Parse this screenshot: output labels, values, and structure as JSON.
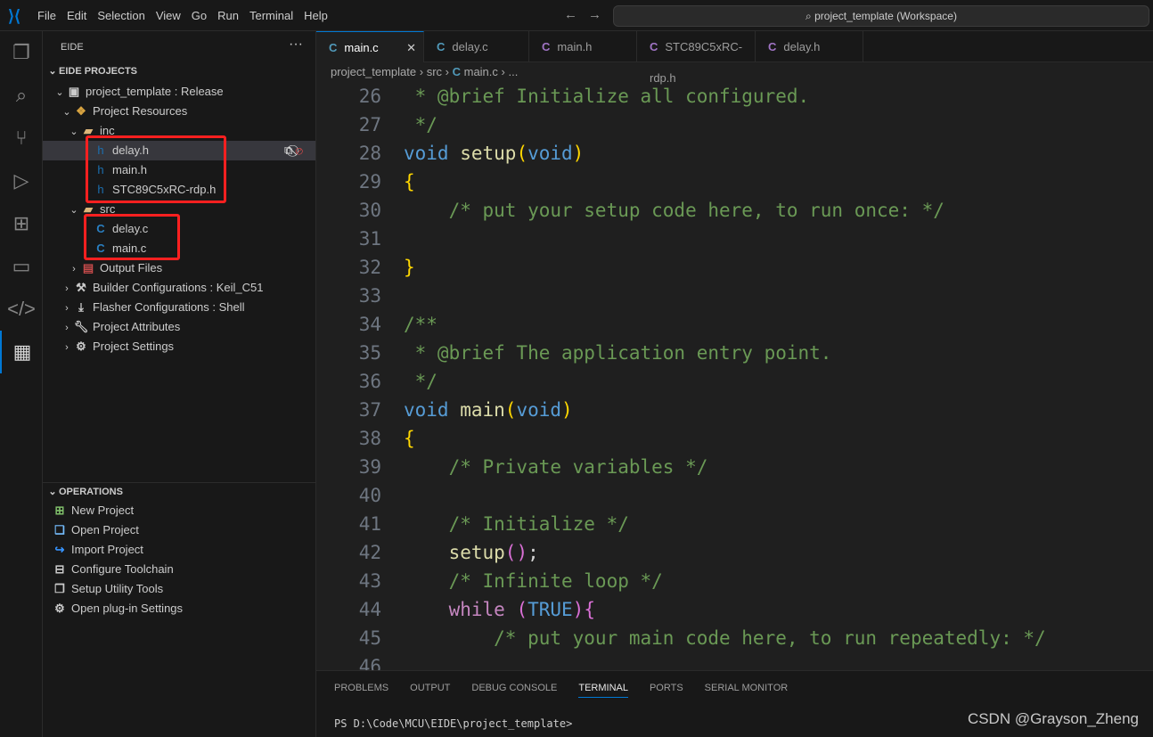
{
  "menu": [
    "File",
    "Edit",
    "Selection",
    "View",
    "Go",
    "Run",
    "Terminal",
    "Help"
  ],
  "search": "project_template (Workspace)",
  "sidebar": {
    "title": "EIDE",
    "projects_header": "EIDE PROJECTS",
    "tree": [
      {
        "label": "project_template : Release",
        "icon": "project-icon"
      },
      {
        "label": "Project Resources",
        "icon": "resources-icon"
      },
      {
        "label": "inc",
        "icon": "folder-icon"
      },
      {
        "label": "delay.h",
        "icon": "h"
      },
      {
        "label": "main.h",
        "icon": "h"
      },
      {
        "label": "STC89C5xRC-rdp.h",
        "icon": "h"
      },
      {
        "label": "src",
        "icon": "folder-icon"
      },
      {
        "label": "delay.c",
        "icon": "C"
      },
      {
        "label": "main.c",
        "icon": "C"
      },
      {
        "label": "Output Files",
        "icon": "output-icon"
      },
      {
        "label": "Builder Configurations : Keil_C51",
        "icon": "builder-icon"
      },
      {
        "label": "Flasher Configurations : Shell",
        "icon": "flasher-icon"
      },
      {
        "label": "Project Attributes",
        "icon": "wrench-icon"
      },
      {
        "label": "Project Settings",
        "icon": "gear-icon"
      }
    ],
    "operations_header": "OPERATIONS",
    "operations": [
      "New Project",
      "Open Project",
      "Import Project",
      "Configure Toolchain",
      "Setup Utility Tools",
      "Open plug-in Settings"
    ]
  },
  "tabs": [
    {
      "label": "main.c",
      "icon": "C",
      "color": "#519aba"
    },
    {
      "label": "delay.c",
      "icon": "C",
      "color": "#519aba"
    },
    {
      "label": "main.h",
      "icon": "C",
      "color": "#a074c4"
    },
    {
      "label": "STC89C5xRC-rdp.h",
      "icon": "C",
      "color": "#a074c4"
    },
    {
      "label": "delay.h",
      "icon": "C",
      "color": "#a074c4"
    }
  ],
  "breadcrumb": [
    "project_template",
    "src",
    "main.c",
    "..."
  ],
  "code": [
    {
      "n": "26",
      "t": [
        [
          " * @brief Initialize all configured.",
          "cm"
        ]
      ]
    },
    {
      "n": "27",
      "t": [
        [
          " */",
          "cm"
        ]
      ]
    },
    {
      "n": "28",
      "t": [
        [
          "void ",
          "kw"
        ],
        [
          "setup",
          "fn"
        ],
        [
          "(",
          "br"
        ],
        [
          "void",
          "kw"
        ],
        [
          ")",
          "br"
        ]
      ]
    },
    {
      "n": "29",
      "t": [
        [
          "{",
          "br"
        ]
      ]
    },
    {
      "n": "30",
      "t": [
        [
          "    /* put your setup code here, to run once: */",
          "cm"
        ]
      ]
    },
    {
      "n": "31",
      "t": []
    },
    {
      "n": "32",
      "t": [
        [
          "}",
          "br"
        ]
      ]
    },
    {
      "n": "33",
      "t": []
    },
    {
      "n": "34",
      "t": [
        [
          "/**",
          "cm"
        ]
      ]
    },
    {
      "n": "35",
      "t": [
        [
          " * @brief The application entry point.",
          "cm"
        ]
      ]
    },
    {
      "n": "36",
      "t": [
        [
          " */",
          "cm"
        ]
      ]
    },
    {
      "n": "37",
      "t": [
        [
          "void ",
          "kw"
        ],
        [
          "main",
          "fn"
        ],
        [
          "(",
          "br"
        ],
        [
          "void",
          "kw"
        ],
        [
          ")",
          "br"
        ]
      ]
    },
    {
      "n": "38",
      "t": [
        [
          "{",
          "br"
        ]
      ]
    },
    {
      "n": "39",
      "t": [
        [
          "    /* Private variables */",
          "cm"
        ]
      ]
    },
    {
      "n": "40",
      "t": []
    },
    {
      "n": "41",
      "t": [
        [
          "    /* Initialize */",
          "cm"
        ]
      ]
    },
    {
      "n": "42",
      "t": [
        [
          "    ",
          "pl"
        ],
        [
          "setup",
          "fn"
        ],
        [
          "()",
          "br2"
        ],
        [
          ";",
          "pl"
        ]
      ]
    },
    {
      "n": "43",
      "t": [
        [
          "    /* Infinite loop */",
          "cm"
        ]
      ]
    },
    {
      "n": "44",
      "t": [
        [
          "    ",
          "pl"
        ],
        [
          "while ",
          "pk"
        ],
        [
          "(",
          "br2"
        ],
        [
          "TRUE",
          "kw"
        ],
        [
          ")",
          "br2"
        ],
        [
          "{",
          "br2"
        ]
      ]
    },
    {
      "n": "45",
      "t": [
        [
          "        /* put your main code here, to run repeatedly: */",
          "cm"
        ]
      ]
    },
    {
      "n": "46",
      "t": []
    }
  ],
  "panel": {
    "tabs": [
      "PROBLEMS",
      "OUTPUT",
      "DEBUG CONSOLE",
      "TERMINAL",
      "PORTS",
      "SERIAL MONITOR"
    ],
    "active": "TERMINAL",
    "terminal": "PS D:\\Code\\MCU\\EIDE\\project_template>"
  },
  "watermark": "CSDN @Grayson_Zheng"
}
